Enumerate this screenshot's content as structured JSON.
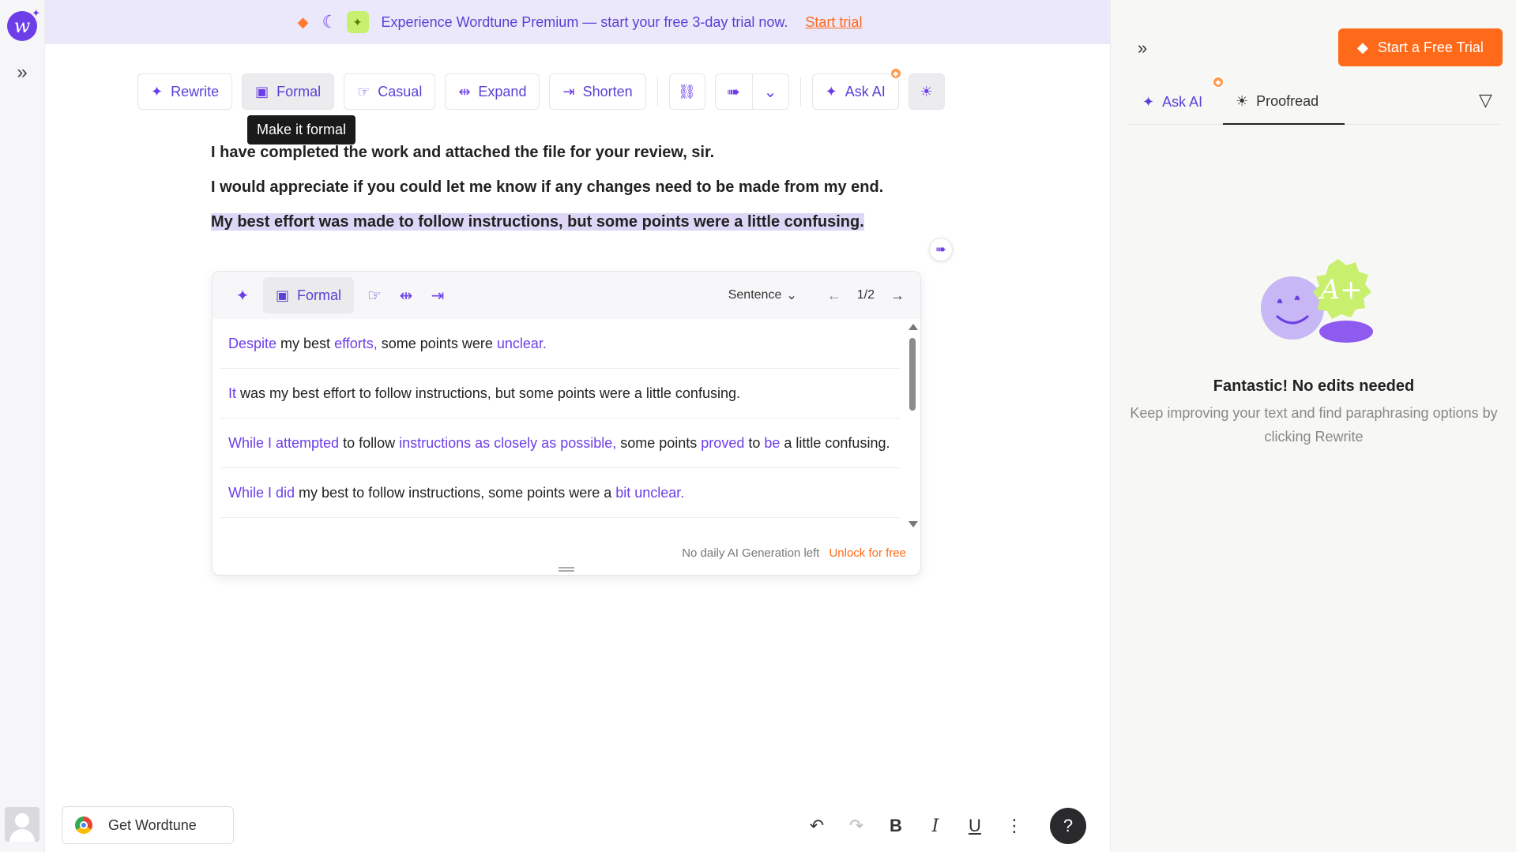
{
  "banner": {
    "text": "Experience Wordtune Premium — start your free 3-day trial now.",
    "link": "Start trial"
  },
  "toolbar": {
    "rewrite": "Rewrite",
    "formal": "Formal",
    "casual": "Casual",
    "expand": "Expand",
    "shorten": "Shorten",
    "ask_ai": "Ask AI",
    "tooltip": "Make it formal"
  },
  "document": {
    "p1": "I have completed the work and attached the file for your review, sir.",
    "p2": "I would appreciate if you could let me know if any changes need to be made from my end.",
    "p3": "My best effort was made to follow instructions, but some points were a little confusing."
  },
  "suggestions": {
    "mode_label": "Formal",
    "scope": "Sentence",
    "pager": "1/2",
    "items": [
      [
        {
          "t": "Despite",
          "h": true
        },
        {
          "t": " my best ",
          "h": false
        },
        {
          "t": "efforts,",
          "h": true
        },
        {
          "t": " some points were ",
          "h": false
        },
        {
          "t": "unclear.",
          "h": true
        }
      ],
      [
        {
          "t": "It",
          "h": true
        },
        {
          "t": " was my best effort to follow instructions, but some points were a little confusing.",
          "h": false
        }
      ],
      [
        {
          "t": "While I attempted",
          "h": true
        },
        {
          "t": " to follow ",
          "h": false
        },
        {
          "t": "instructions as closely as possible,",
          "h": true
        },
        {
          "t": " some points ",
          "h": false
        },
        {
          "t": "proved",
          "h": true
        },
        {
          "t": " to ",
          "h": false
        },
        {
          "t": "be",
          "h": true
        },
        {
          "t": " a little confusing.",
          "h": false
        }
      ],
      [
        {
          "t": "While I did",
          "h": true
        },
        {
          "t": " my best to follow instructions, some points were a ",
          "h": false
        },
        {
          "t": "bit unclear.",
          "h": true
        }
      ]
    ],
    "footer_note": "No daily AI Generation left",
    "footer_link": "Unlock for free"
  },
  "bottom": {
    "get_wordtune": "Get Wordtune",
    "help": "?"
  },
  "panel": {
    "trial_button": "Start a Free Trial",
    "tab_ask": "Ask AI",
    "tab_proofread": "Proofread",
    "empty_title": "Fantastic! No edits needed",
    "empty_sub": "Keep improving your text and find paraphrasing options by clicking Rewrite",
    "illustration_text": "A+"
  },
  "colors": {
    "accent": "#6d3ee8",
    "orange": "#ff6a1a",
    "banner_bg": "#ece8fb",
    "selection": "#ddd6f6"
  }
}
